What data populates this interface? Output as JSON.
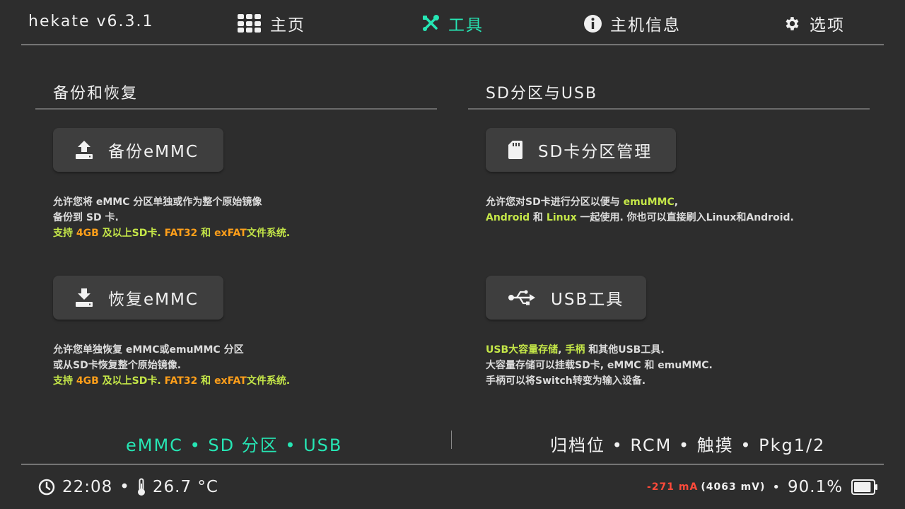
{
  "app": {
    "title": "hekate v6.3.1"
  },
  "tabs": [
    {
      "label": "主页",
      "icon": "grid-icon"
    },
    {
      "label": "工具",
      "icon": "tools-icon",
      "active": true
    },
    {
      "label": "主机信息",
      "icon": "info-icon"
    },
    {
      "label": "选项",
      "icon": "gear-icon"
    }
  ],
  "backup_section": {
    "title": "备份和恢复",
    "backup_button": "备份eMMC",
    "backup_desc": {
      "line1": "允许您将 eMMC 分区单独或作为整个原始镜像",
      "line2": "备份到 SD 卡.",
      "line3": [
        {
          "t": "支持 ",
          "c": "green"
        },
        {
          "t": "4GB",
          "c": "orange"
        },
        {
          "t": " 及以上SD卡. ",
          "c": "green"
        },
        {
          "t": "FAT32",
          "c": "orange"
        },
        {
          "t": " 和 ",
          "c": "green"
        },
        {
          "t": "exFAT",
          "c": "orange"
        },
        {
          "t": "文件系统.",
          "c": "green"
        }
      ]
    },
    "restore_button": "恢复eMMC",
    "restore_desc": {
      "line1": "允许您单独恢复 eMMC或emuMMC 分区",
      "line2": "或从SD卡恢复整个原始镜像.",
      "line3": [
        {
          "t": "支持 ",
          "c": "green"
        },
        {
          "t": "4GB",
          "c": "orange"
        },
        {
          "t": " 及以上SD卡. ",
          "c": "green"
        },
        {
          "t": "FAT32",
          "c": "orange"
        },
        {
          "t": " 和 ",
          "c": "green"
        },
        {
          "t": "exFAT",
          "c": "orange"
        },
        {
          "t": "文件系统.",
          "c": "green"
        }
      ]
    }
  },
  "sd_section": {
    "title": "SD分区与USB",
    "partition_button": "SD卡分区管理",
    "partition_desc": {
      "line1": [
        {
          "t": "允许您对SD卡进行分区以便与 ",
          "c": ""
        },
        {
          "t": "emuMMC",
          "c": "green"
        },
        {
          "t": ",",
          "c": ""
        }
      ],
      "line2": [
        {
          "t": "Android",
          "c": "green"
        },
        {
          "t": " 和 ",
          "c": ""
        },
        {
          "t": "Linux",
          "c": "green"
        },
        {
          "t": " 一起使用. 你也可以直接刷入Linux和Android.",
          "c": ""
        }
      ]
    },
    "usb_button": "USB工具",
    "usb_desc": {
      "line1": [
        {
          "t": "USB大容量存储",
          "c": "green"
        },
        {
          "t": ", ",
          "c": ""
        },
        {
          "t": "手柄",
          "c": "green"
        },
        {
          "t": " 和其他USB工具.",
          "c": ""
        }
      ],
      "line2": "大容量存储可以挂载SD卡, eMMC 和 emuMMC.",
      "line3": "手柄可以将Switch转变为输入设备."
    }
  },
  "footer": {
    "left_shortcuts": "eMMC • SD 分区 • USB",
    "right_shortcuts": "归档位 • RCM • 触摸 • Pkg1/2"
  },
  "status": {
    "time": "22:08",
    "separator": "•",
    "temperature": "26.7 °C",
    "current": "-271 mA",
    "voltage": "(4063 mV)",
    "battery_separator": "•",
    "battery_percent": "90.1%",
    "battery_level": 0.901
  },
  "colors": {
    "accent": "#26e6b4",
    "highlight_green": "#c4e648",
    "highlight_orange": "#ff9f1a",
    "current_red": "#ff4a3a",
    "background": "#2d2d2d",
    "button": "#3e3e3e"
  }
}
